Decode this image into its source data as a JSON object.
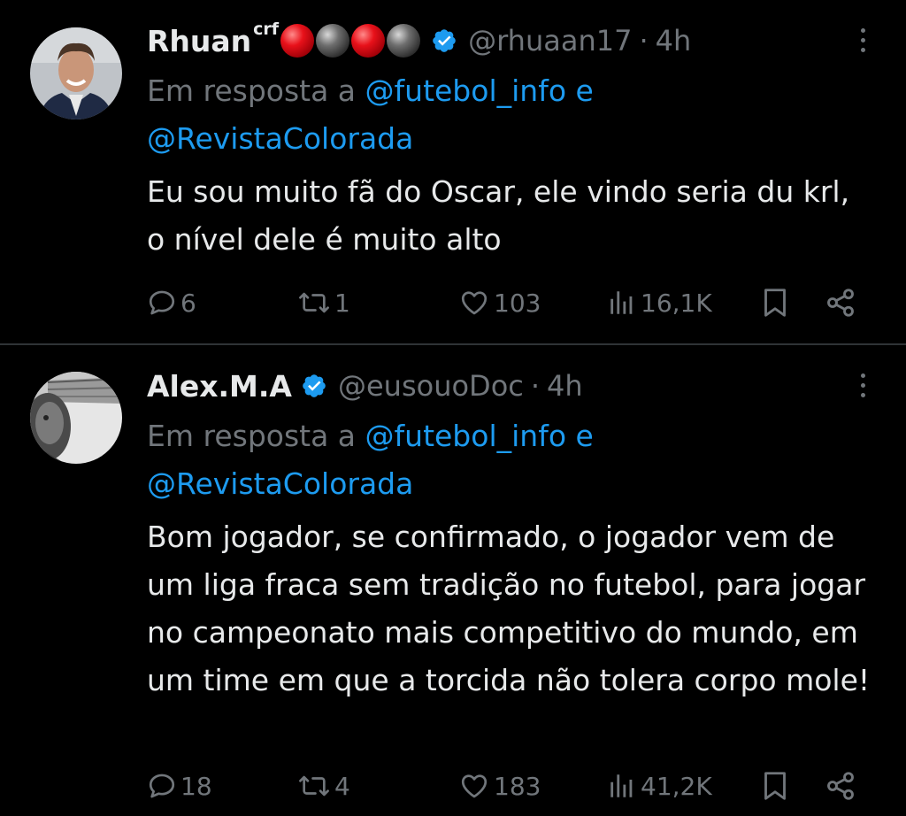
{
  "tweets": [
    {
      "name": "Rhuan",
      "name_sup": "crf",
      "name_emoji_balls": [
        "red",
        "black",
        "red",
        "black"
      ],
      "verified": true,
      "handle": "@rhuaan17",
      "separator": "·",
      "time": "4h",
      "reply_prefix": "Em resposta a",
      "reply_mention_1": "@futebol_info",
      "reply_joiner": "e",
      "reply_mention_2": "@RevistaColorada",
      "text": "Eu sou muito fã do Oscar, ele vindo seria du krl, o nível dele é muito alto",
      "actions": {
        "replies": "6",
        "retweets": "1",
        "likes": "103",
        "views": "16,1K"
      }
    },
    {
      "name": "Alex.M.A",
      "verified": true,
      "handle": "@eusouoDoc",
      "separator": "·",
      "time": "4h",
      "reply_prefix": "Em resposta a",
      "reply_mention_1": "@futebol_info",
      "reply_joiner": "e",
      "reply_mention_2": "@RevistaColorada",
      "text": "Bom jogador, se confirmado, o jogador vem de um liga fraca sem tradição no futebol, para jogar no campeonato mais competitivo do mundo, em um time em que a torcida não tolera corpo mole!",
      "actions": {
        "replies": "18",
        "retweets": "4",
        "likes": "183",
        "views": "41,2K"
      }
    }
  ],
  "colors": {
    "background": "#000000",
    "text_primary": "#e7e9ea",
    "text_secondary": "#71767b",
    "link": "#1d9bf0",
    "verified": "#1d9bf0",
    "divider": "#2f3336"
  },
  "icons": {
    "reply": "speech-bubble-icon",
    "retweet": "retweet-arrows-icon",
    "like": "heart-icon",
    "views": "bar-chart-icon",
    "bookmark": "bookmark-icon",
    "share": "share-icon",
    "more": "vertical-ellipsis-icon",
    "verified": "verified-badge-icon"
  }
}
